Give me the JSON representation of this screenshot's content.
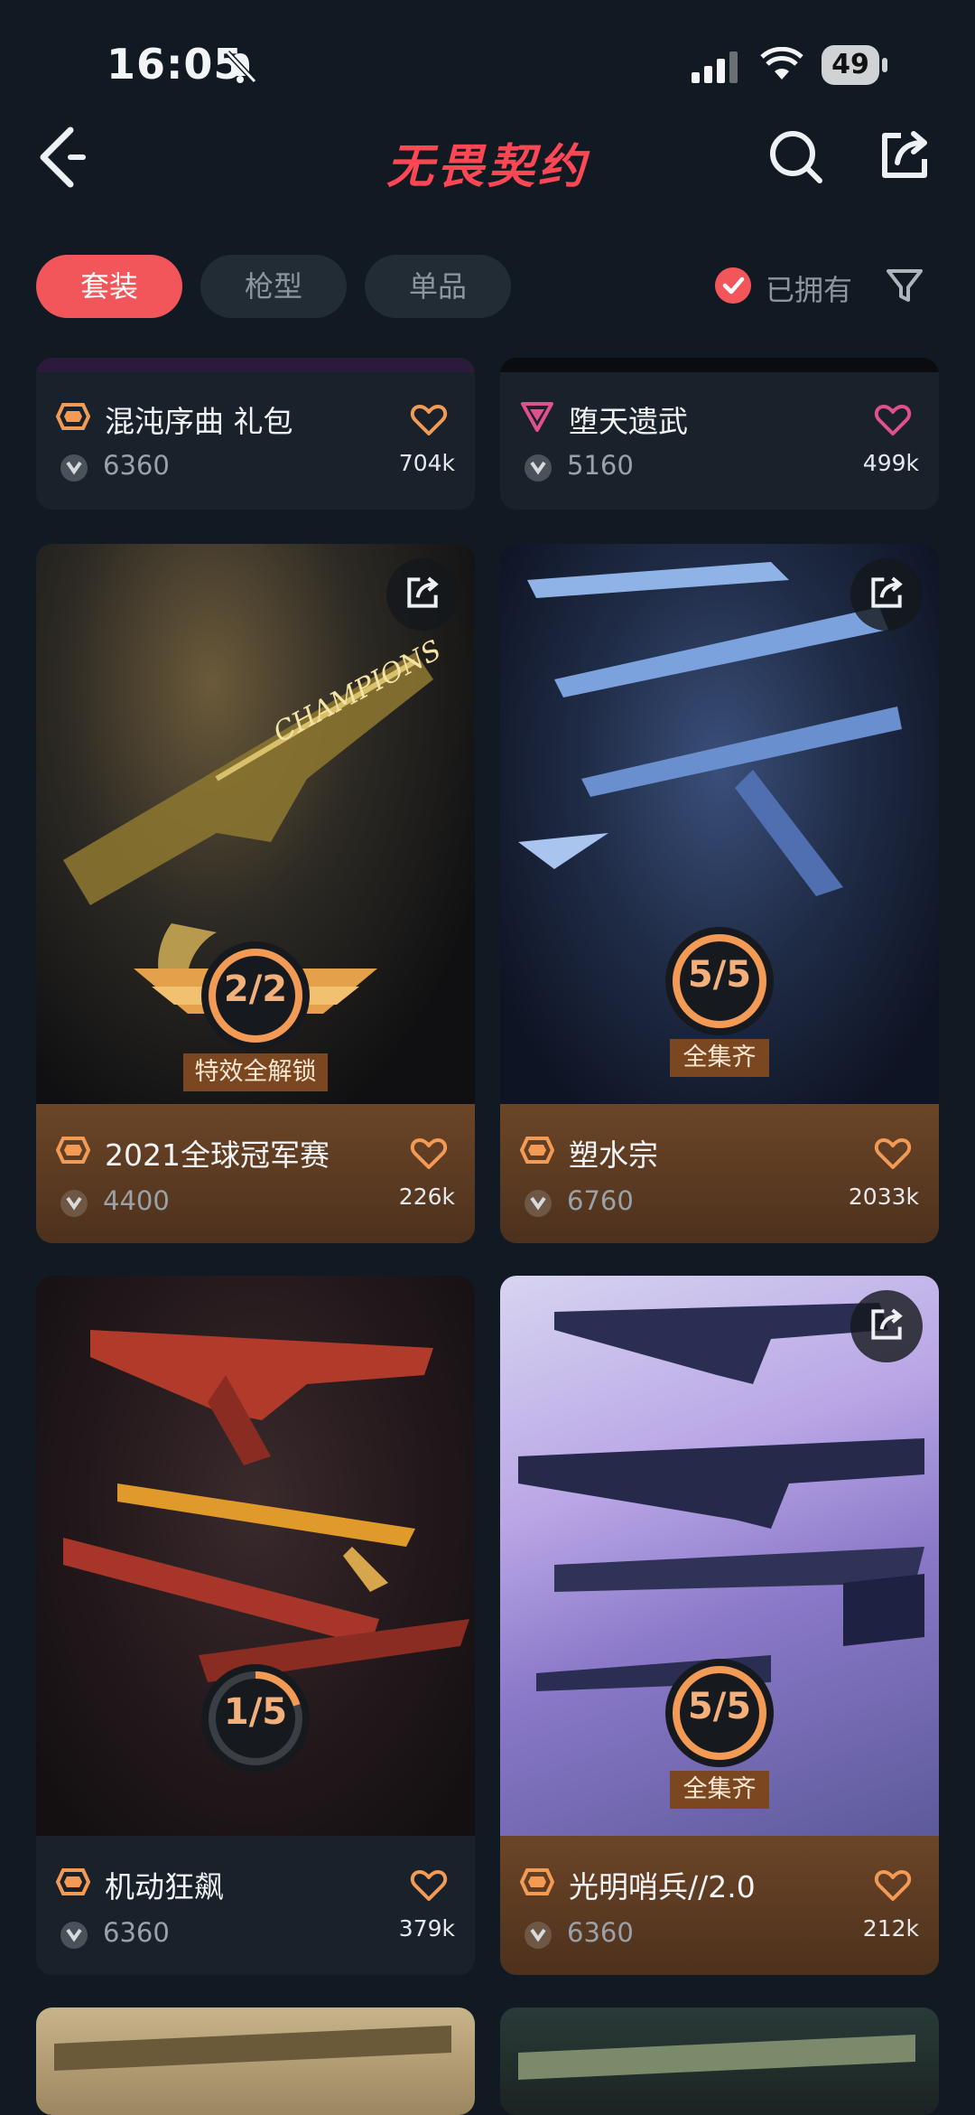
{
  "status_bar": {
    "time": "16:05",
    "battery": "49"
  },
  "header": {
    "title": "无畏契约"
  },
  "filters": {
    "tabs": [
      {
        "label": "套装",
        "active": true
      },
      {
        "label": "枪型",
        "active": false
      },
      {
        "label": "单品",
        "active": false
      }
    ],
    "owned_label": "已拥有"
  },
  "colors": {
    "accent": "#f2555a",
    "brand": "#ff4655",
    "badge": "#f39a55",
    "gold_panel": "#5d3c22"
  },
  "cards": [
    {
      "name": "混沌序曲 礼包",
      "price": "6360",
      "likes": "704k",
      "tier": "deluxe"
    },
    {
      "name": "堕天遗武",
      "price": "5160",
      "likes": "499k",
      "tier": "premium"
    },
    {
      "name": "2021全球冠军赛",
      "price": "4400",
      "likes": "226k",
      "tier": "deluxe",
      "progress": "2/2",
      "progress_done": 2,
      "progress_total": 2,
      "ribbon": "特效全解锁"
    },
    {
      "name": "塑水宗",
      "price": "6760",
      "likes": "2033k",
      "tier": "deluxe",
      "progress": "5/5",
      "progress_done": 5,
      "progress_total": 5,
      "ribbon": "全集齐"
    },
    {
      "name": "机动狂飙",
      "price": "6360",
      "likes": "379k",
      "tier": "deluxe",
      "progress": "1/5",
      "progress_done": 1,
      "progress_total": 5
    },
    {
      "name": "光明哨兵//2.0",
      "price": "6360",
      "likes": "212k",
      "tier": "deluxe",
      "progress": "5/5",
      "progress_done": 5,
      "progress_total": 5,
      "ribbon": "全集齐"
    }
  ]
}
